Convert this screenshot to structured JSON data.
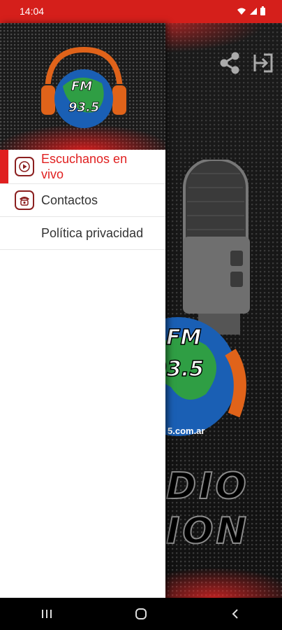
{
  "status_bar": {
    "time": "14:04"
  },
  "app": {
    "logo_text_line1": "FM",
    "logo_text_line2": "93.5",
    "brand_line1": "DIO",
    "brand_line2": "ION",
    "url_fragment": "5.com.ar",
    "actions": {
      "share_icon": "share-icon",
      "exit_icon": "exit-icon"
    }
  },
  "drawer": {
    "items": [
      {
        "label": "Escuchanos en vivo",
        "icon": "play-icon",
        "active": true
      },
      {
        "label": "Contactos",
        "icon": "phone-icon",
        "active": false
      },
      {
        "label": "Política privacidad",
        "icon": "",
        "active": false
      }
    ]
  },
  "colors": {
    "accent": "#e02020",
    "status_bar": "#d51f1b",
    "drawer_bg": "#ffffff"
  }
}
